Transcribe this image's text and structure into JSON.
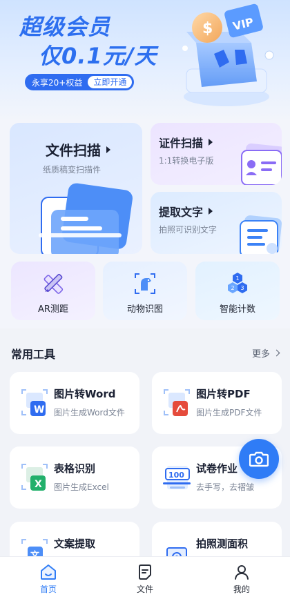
{
  "banner": {
    "title_line1": "超级会员",
    "title_line2": "仅0.1元/天",
    "perk_text": "永享20+权益",
    "open_button": "立即开通",
    "vip_badge": "VIP",
    "coin_symbol": "$"
  },
  "features": {
    "doc_scan": {
      "title": "文件扫描",
      "subtitle": "纸质稿变扫描件"
    },
    "id_scan": {
      "title": "证件扫描",
      "subtitle": "1:1转换电子版"
    },
    "text_extract": {
      "title": "提取文字",
      "subtitle": "拍照可识别文字"
    }
  },
  "mini_features": [
    {
      "label": "AR测距",
      "icon": "ruler-pencil-icon"
    },
    {
      "label": "动物识图",
      "icon": "animal-scan-icon"
    },
    {
      "label": "智能计数",
      "icon": "counting-hexagons-icon"
    }
  ],
  "tools_section": {
    "title": "常用工具",
    "more_label": "更多",
    "items": [
      {
        "title": "图片转Word",
        "subtitle": "图片生成Word文件",
        "badge": "W",
        "icon": "image-to-word-icon"
      },
      {
        "title": "图片转PDF",
        "subtitle": "图片生成PDF文件",
        "badge": "PDF",
        "icon": "image-to-pdf-icon"
      },
      {
        "title": "表格识别",
        "subtitle": "图片生成Excel",
        "badge": "X",
        "icon": "table-recognition-icon"
      },
      {
        "title": "试卷作业",
        "subtitle": "去手写，去褶皱",
        "badge": "100",
        "icon": "exam-paper-icon"
      },
      {
        "title": "文案提取",
        "subtitle": "",
        "badge": "文",
        "icon": "copy-extract-icon"
      },
      {
        "title": "拍照测面积",
        "subtitle": "",
        "badge": "",
        "icon": "area-measure-icon"
      }
    ]
  },
  "bottom_nav": [
    {
      "label": "首页",
      "icon": "home-icon",
      "active": true
    },
    {
      "label": "文件",
      "icon": "file-icon",
      "active": false
    },
    {
      "label": "我的",
      "icon": "profile-icon",
      "active": false
    }
  ],
  "colors": {
    "accent": "#2f7cf6",
    "banner_blue": "#2d6fef",
    "word_blue": "#2f6cf0",
    "pdf_red": "#e54b3c",
    "excel_green": "#22b06b"
  }
}
